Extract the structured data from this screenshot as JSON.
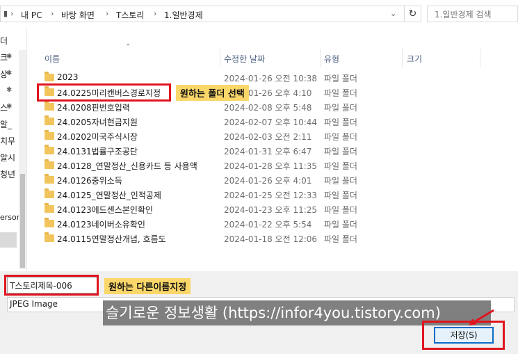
{
  "address": {
    "crumbs": [
      "내 PC",
      "바탕 화면",
      "T스토리",
      "1.일반경제"
    ],
    "search_placeholder": "1.일반경제 검색"
  },
  "nav": {
    "items": [
      "ㅡ",
      "더",
      "크",
      "상",
      "",
      "",
      "스",
      "알_",
      "치무",
      "알시",
      "청년",
      "erson"
    ]
  },
  "columns": {
    "name": "이름",
    "date": "수정한 날짜",
    "type": "유형",
    "size": "크기"
  },
  "files": [
    {
      "name": "2023",
      "date": "2024-01-26 오전 10:38",
      "type": "파일 폴더"
    },
    {
      "name": "24.0225미리캔버스경로지정",
      "date": "2024-01-26 오후 4:10",
      "type": "파일 폴더"
    },
    {
      "name": "24.0208핀번호입력",
      "date": "2024-02-08 오후 5:48",
      "type": "파일 폴더"
    },
    {
      "name": "24.0205자녀현금지원",
      "date": "2024-02-07 오후 10:44",
      "type": "파일 폴더"
    },
    {
      "name": "24.0202미국주식시장",
      "date": "2024-02-03 오전 2:11",
      "type": "파일 폴더"
    },
    {
      "name": "24.0131법률구조공단",
      "date": "2024-01-31 오후 6:47",
      "type": "파일 폴더"
    },
    {
      "name": "24.0128_연말정산_신용카드 등 사용액",
      "date": "2024-01-28 오후 11:35",
      "type": "파일 폴더"
    },
    {
      "name": "24.0126중위소득",
      "date": "2024-01-26 오후 4:01",
      "type": "파일 폴더"
    },
    {
      "name": "24.0125_연말정산_인적공제",
      "date": "2024-01-25 오전 12:33",
      "type": "파일 폴더"
    },
    {
      "name": "24.0123에드센스본인확인",
      "date": "2024-01-23 오후 11:25",
      "type": "파일 폴더"
    },
    {
      "name": "24.0123네이버소유확인",
      "date": "2024-01-22 오후 5:54",
      "type": "파일 폴더"
    },
    {
      "name": "24.0115연말정산개념, 흐름도",
      "date": "2024-01-18 오전 12:06",
      "type": "파일 폴더"
    }
  ],
  "annotations": {
    "folder_callout": "원하는 폴더 선택",
    "name_callout": "원하는 다른이름지정"
  },
  "save": {
    "filename": "T스토리제목-006",
    "filetype": "JPEG Image",
    "save_label": "저장(S)"
  },
  "watermark": "슬기로운 정보생활 (https://infor4you.tistory.com)",
  "colors": {
    "highlight": "#e0141e",
    "callout_bg": "#fbd76a",
    "folder": "#f2c55c",
    "button_border": "#0a6bc9"
  }
}
